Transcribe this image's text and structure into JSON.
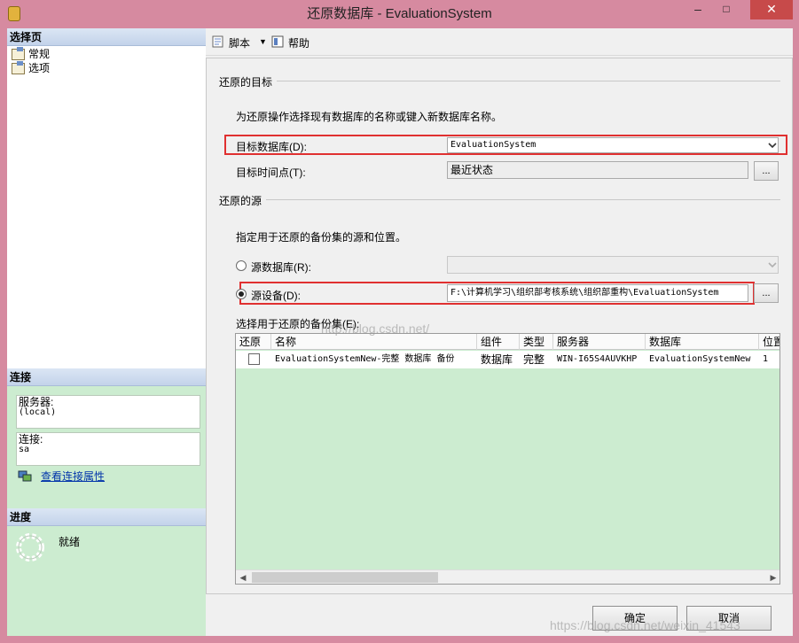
{
  "window": {
    "title": "还原数据库 - EvaluationSystem",
    "minimize": "–",
    "maximize": "□",
    "close": "✕"
  },
  "left": {
    "select_page_header": "选择页",
    "pages": [
      {
        "label": "常规"
      },
      {
        "label": "选项"
      }
    ],
    "connection_header": "连接",
    "server_label": "服务器:",
    "server_value": "(local)",
    "conn_label": "连接:",
    "conn_value": "sa",
    "view_conn_props": "查看连接属性",
    "progress_header": "进度",
    "progress_status": "就绪"
  },
  "toolbar": {
    "script": "脚本",
    "script_arrow": "▼",
    "help": "帮助"
  },
  "target": {
    "section": "还原的目标",
    "desc": "为还原操作选择现有数据库的名称或键入新数据库名称。",
    "db_label": "目标数据库(D):",
    "db_value": "EvaluationSystem",
    "time_label": "目标时间点(T):",
    "time_value": "最近状态",
    "dots": "..."
  },
  "source": {
    "section": "还原的源",
    "desc": "指定用于还原的备份集的源和位置。",
    "from_db_label": "源数据库(R):",
    "from_device_label": "源设备(D):",
    "device_path": "F:\\计算机学习\\组织部考核系统\\组织部重构\\EvaluationSystem",
    "dots": "...",
    "selected": "device"
  },
  "backup": {
    "label": "选择用于还原的备份集(E):",
    "columns": [
      "还原",
      "名称",
      "组件",
      "类型",
      "服务器",
      "数据库",
      "位置"
    ],
    "rows": [
      {
        "restore": false,
        "name": "EvaluationSystemNew-完整 数据库 备份",
        "component": "数据库",
        "type": "完整",
        "server": "WIN-I65S4AUVKHP",
        "database": "EvaluationSystemNew",
        "position": "1"
      }
    ],
    "scroll_left": "◀",
    "scroll_right": "▶"
  },
  "buttons": {
    "ok": "确定",
    "cancel": "取消"
  },
  "watermarks": {
    "center": "http://blog.csdn.net/",
    "bottom": "https://blog.csdn.net/weixin_41543"
  }
}
